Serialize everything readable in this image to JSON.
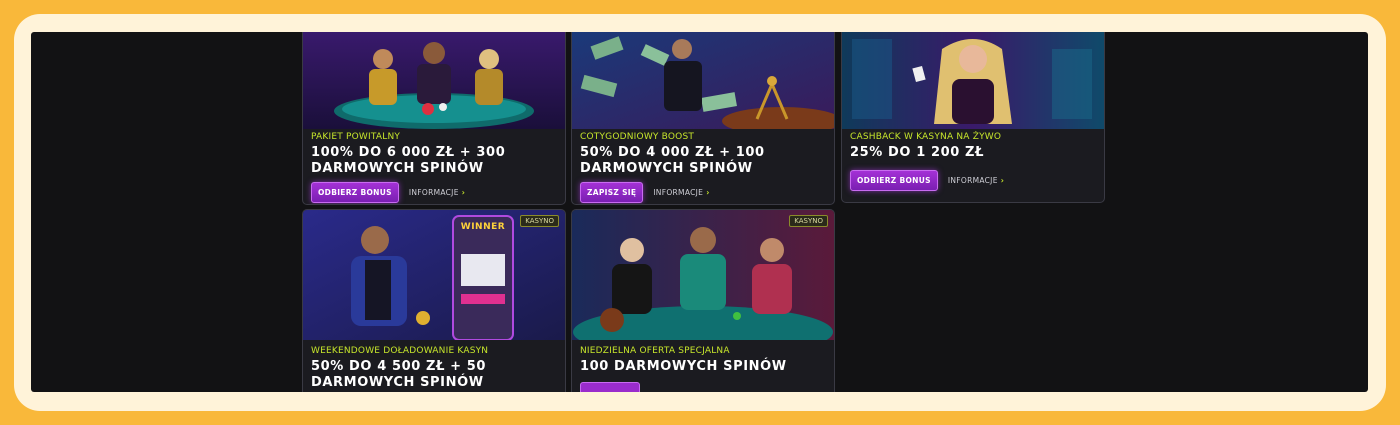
{
  "cards": [
    {
      "category": "PAKIET POWITALNY",
      "title_line1": "100% DO 6 000 ZŁ + 300",
      "title_line2": "DARMOWYCH SPINÓW",
      "button": "ODBIERZ BONUS",
      "info": "INFORMACJE",
      "art": "poker-table-three-players"
    },
    {
      "category": "COTYGODNIOWY BOOST",
      "title_line1": "50% DO 4 000 ZŁ + 100",
      "title_line2": "DARMOWYCH SPINÓW",
      "button": "ZAPISZ SIĘ",
      "info": "INFORMACJE",
      "art": "money-rain-roulette"
    },
    {
      "category": "CASHBACK W KASYNA NA ŻYWO",
      "title_line1": "25% DO 1 200 ZŁ",
      "title_line2": "",
      "button": "ODBIERZ BONUS",
      "info": "INFORMACJE",
      "art": "woman-with-cards-neon"
    },
    {
      "badge": "KASYNO",
      "category": "WEEKENDOWE DOŁADOWANIE KASYN",
      "title_line1": "50% DO 4 500 ZŁ + 50",
      "title_line2": "DARMOWYCH SPINÓW",
      "art": "slot-machine-winner"
    },
    {
      "badge": "KASYNO",
      "category": "NIEDZIELNA OFERTA SPECJALNA",
      "title_line1": "100 DARMOWYCH SPINÓW",
      "art": "roulette-table-three-players"
    }
  ],
  "slot_sign": "WINNER",
  "colors": {
    "accent_lime": "#c6e52b",
    "button_purple": "#8a24c4",
    "frame_orange": "#f9b83a"
  }
}
